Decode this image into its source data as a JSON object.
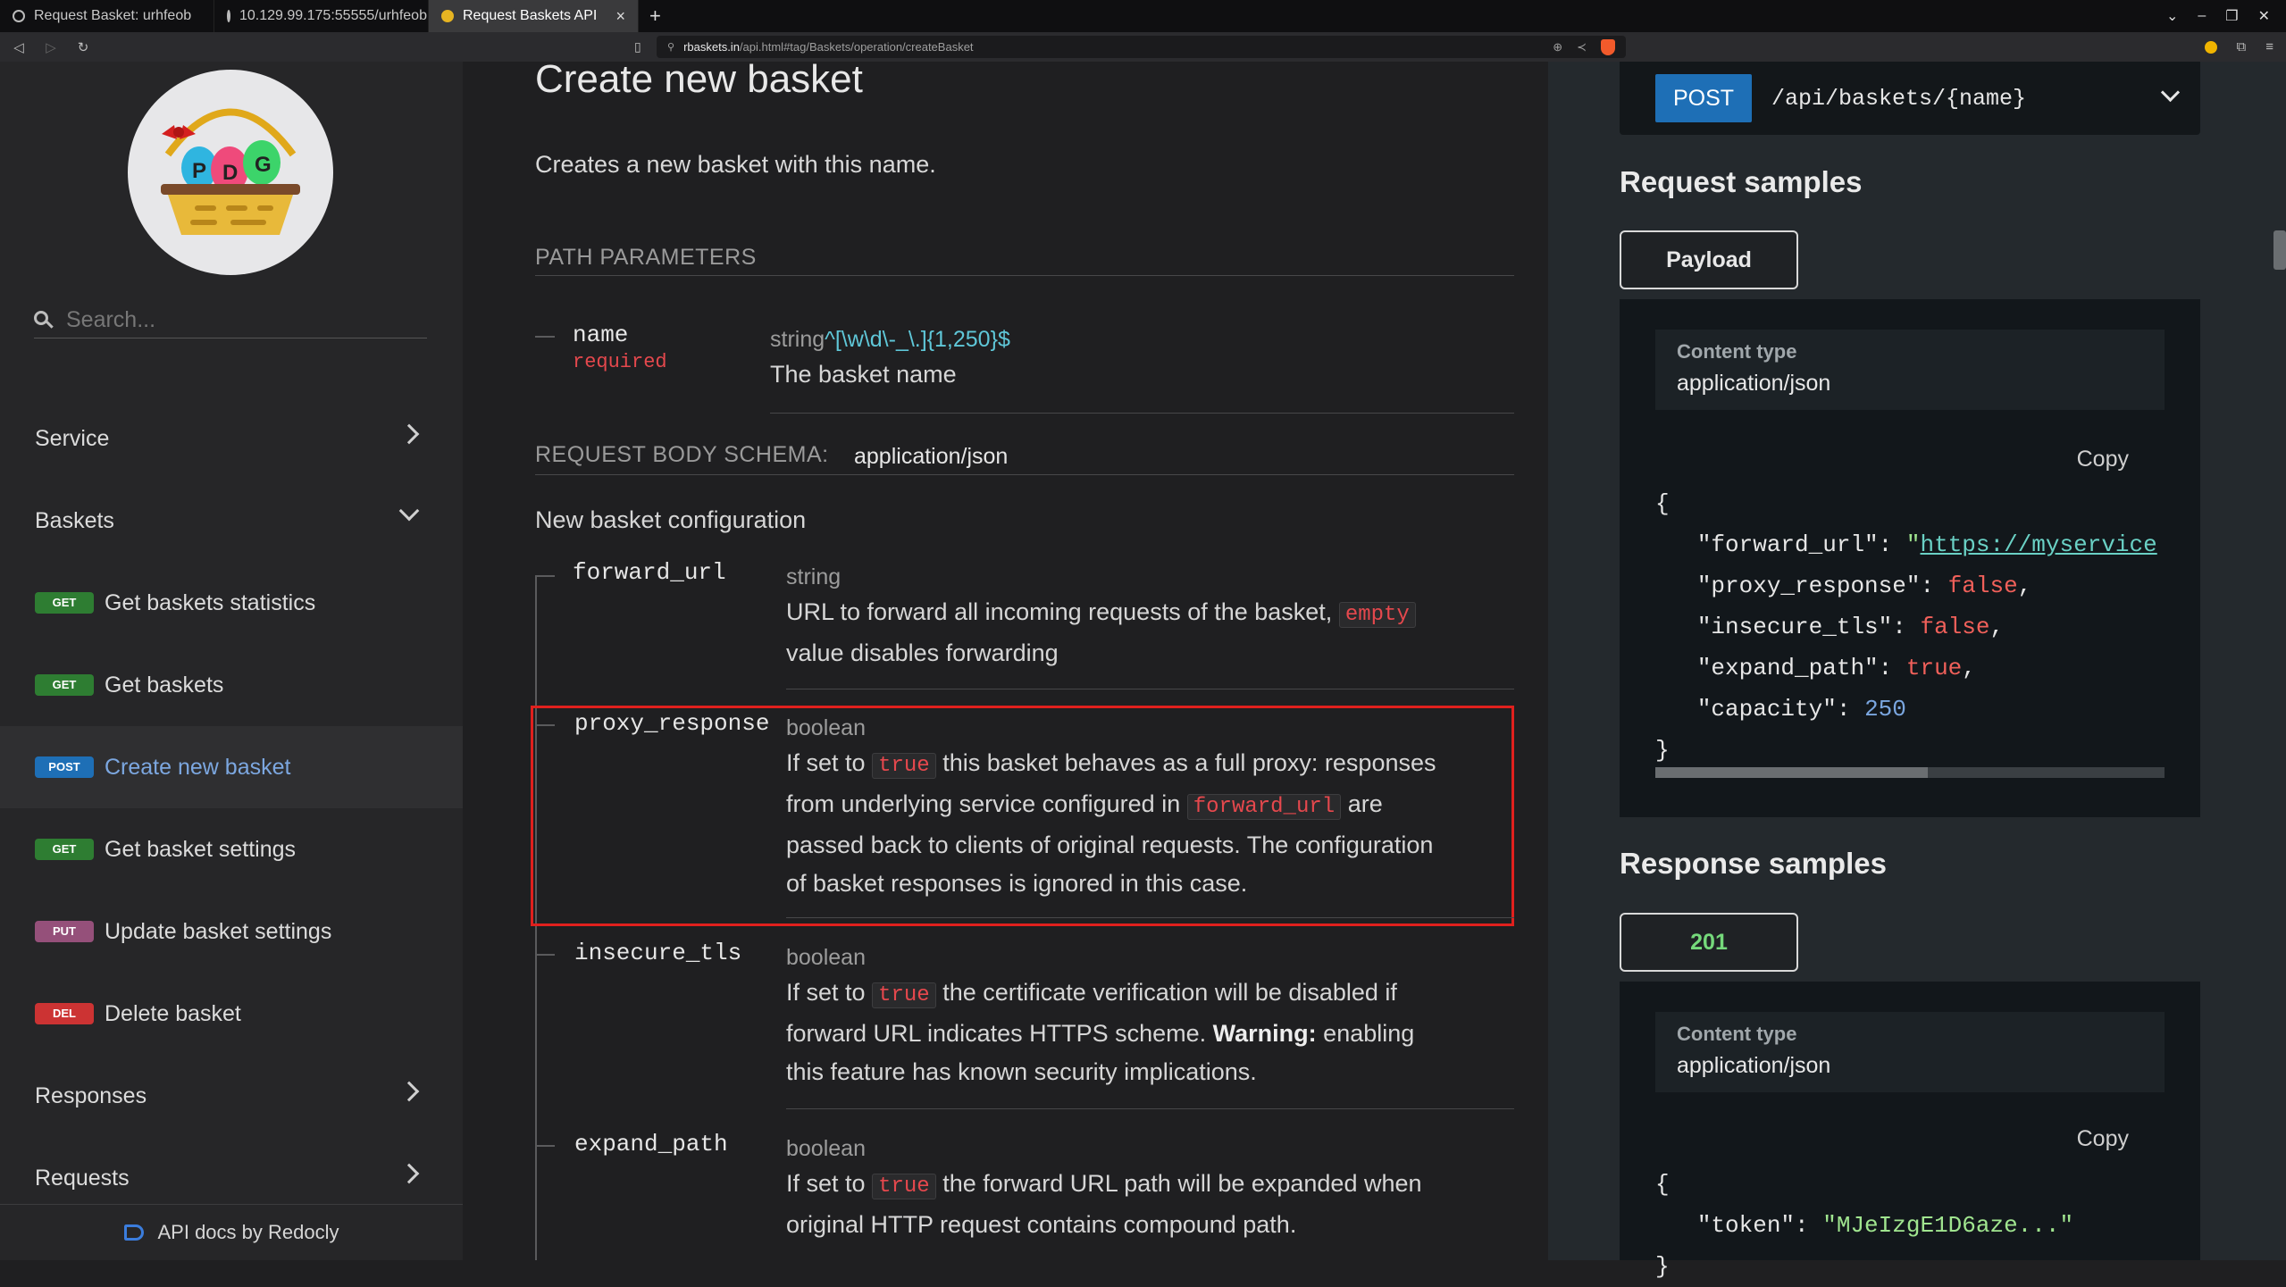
{
  "browser": {
    "tabs": [
      {
        "title": "Request Basket: urhfeob"
      },
      {
        "title": "10.129.99.175:55555/urhfeob"
      },
      {
        "title": "Request Baskets API"
      }
    ],
    "url_host": "rbaskets.in",
    "url_path": "/api.html#tag/Baskets/operation/createBasket"
  },
  "sidebar": {
    "search_placeholder": "Search...",
    "groups": [
      {
        "label": "Service"
      },
      {
        "label": "Baskets"
      },
      {
        "label": "Responses"
      },
      {
        "label": "Requests"
      }
    ],
    "operations": [
      {
        "method": "GET",
        "label": "Get baskets statistics",
        "color": "#2e7d32"
      },
      {
        "method": "GET",
        "label": "Get baskets",
        "color": "#2e7d32"
      },
      {
        "method": "POST",
        "label": "Create new basket",
        "color": "#1e6fb6"
      },
      {
        "method": "GET",
        "label": "Get basket settings",
        "color": "#2e7d32"
      },
      {
        "method": "PUT",
        "label": "Update basket settings",
        "color": "#95507a"
      },
      {
        "method": "DEL",
        "label": "Delete basket",
        "color": "#cc3333"
      }
    ],
    "footer": "API docs by Redocly"
  },
  "content": {
    "title": "Create new basket",
    "description": "Creates a new basket with this name.",
    "path_params_label": "PATH PARAMETERS",
    "path_param": {
      "name": "name",
      "required": "required",
      "type": "string",
      "pattern": "^[\\w\\d\\-_\\.]{1,250}$",
      "desc": "The basket name"
    },
    "body_schema_label": "REQUEST BODY SCHEMA:",
    "body_schema_type": "application/json",
    "body_desc": "New basket configuration",
    "fields": {
      "forward_url": {
        "name": "forward_url",
        "type": "string",
        "text1": "URL to forward all incoming requests of the basket,",
        "code": "empty",
        "text2": "value disables forwarding"
      },
      "proxy_response": {
        "name": "proxy_response",
        "type": "boolean",
        "t1": "If set to",
        "code1": "true",
        "t2": "this basket behaves as a full proxy: responses",
        "t3": "from underlying service configured in",
        "code2": "forward_url",
        "t4": "are",
        "t5": "passed back to clients of original requests. The configuration",
        "t6": "of basket responses is ignored in this case."
      },
      "insecure_tls": {
        "name": "insecure_tls",
        "type": "boolean",
        "t1": "If set to",
        "code1": "true",
        "t2": "the certificate verification will be disabled if",
        "t3": "forward URL indicates HTTPS scheme.",
        "warn": "Warning:",
        "t4": "enabling",
        "t5": "this feature has known security implications."
      },
      "expand_path": {
        "name": "expand_path",
        "type": "boolean",
        "t1": "If set to",
        "code1": "true",
        "t2": "the forward URL path will be expanded when",
        "t3": "original HTTP request contains compound path."
      }
    }
  },
  "right": {
    "method": "POST",
    "endpoint": "/api/baskets/{name}",
    "request_samples": "Request samples",
    "payload_tab": "Payload",
    "content_type_label": "Content type",
    "content_type": "application/json",
    "copy": "Copy",
    "json": {
      "open": "{",
      "close": "}",
      "forward_url_key": "\"forward_url\"",
      "forward_url_q": "\"",
      "forward_url_val": "https://myservice",
      "proxy_response_key": "\"proxy_response\"",
      "proxy_response_val": "false",
      "insecure_tls_key": "\"insecure_tls\"",
      "insecure_tls_val": "false",
      "expand_path_key": "\"expand_path\"",
      "expand_path_val": "true",
      "capacity_key": "\"capacity\"",
      "capacity_val": "250"
    },
    "response_samples": "Response samples",
    "status_tab": "201",
    "resp_content_type_label": "Content type",
    "resp_content_type": "application/json",
    "resp_copy": "Copy",
    "resp_json": {
      "open": "{",
      "token_key": "\"token\"",
      "token_val": "\"MJeIzgE1D6aze...\"",
      "close": "}"
    }
  }
}
